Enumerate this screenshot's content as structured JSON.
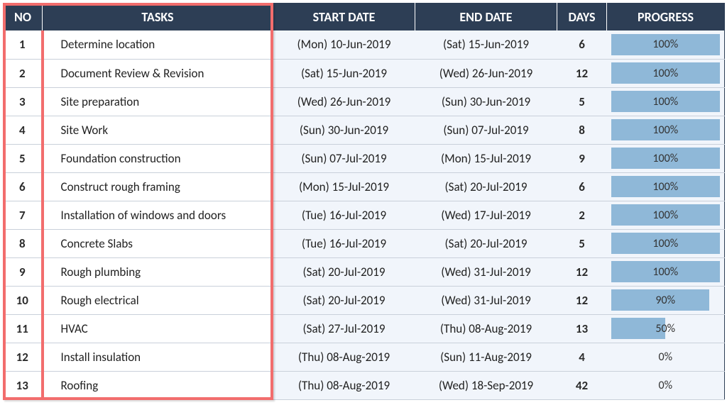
{
  "headers": {
    "no": "NO",
    "tasks": "TASKS",
    "start": "START DATE",
    "end": "END DATE",
    "days": "DAYS",
    "progress": "PROGRESS"
  },
  "rows": [
    {
      "no": "1",
      "task": "Determine location",
      "start": "(Mon) 10-Jun-2019",
      "end": "(Sat) 15-Jun-2019",
      "days": "6",
      "progress": 100
    },
    {
      "no": "2",
      "task": "Document Review & Revision",
      "start": "(Sat) 15-Jun-2019",
      "end": "(Wed) 26-Jun-2019",
      "days": "12",
      "progress": 100
    },
    {
      "no": "3",
      "task": "Site preparation",
      "start": "(Wed) 26-Jun-2019",
      "end": "(Sun) 30-Jun-2019",
      "days": "5",
      "progress": 100
    },
    {
      "no": "4",
      "task": "Site Work",
      "start": "(Sun) 30-Jun-2019",
      "end": "(Sun) 07-Jul-2019",
      "days": "8",
      "progress": 100
    },
    {
      "no": "5",
      "task": "Foundation construction",
      "start": "(Sun) 07-Jul-2019",
      "end": "(Mon) 15-Jul-2019",
      "days": "9",
      "progress": 100
    },
    {
      "no": "6",
      "task": "Construct rough framing",
      "start": "(Mon) 15-Jul-2019",
      "end": "(Sat) 20-Jul-2019",
      "days": "6",
      "progress": 100
    },
    {
      "no": "7",
      "task": "Installation of windows and doors",
      "start": "(Tue) 16-Jul-2019",
      "end": "(Wed) 17-Jul-2019",
      "days": "2",
      "progress": 100
    },
    {
      "no": "8",
      "task": "Concrete Slabs",
      "start": "(Tue) 16-Jul-2019",
      "end": "(Sat) 20-Jul-2019",
      "days": "5",
      "progress": 100
    },
    {
      "no": "9",
      "task": "Rough plumbing",
      "start": "(Sat) 20-Jul-2019",
      "end": "(Wed) 31-Jul-2019",
      "days": "12",
      "progress": 100
    },
    {
      "no": "10",
      "task": "Rough electrical",
      "start": "(Sat) 20-Jul-2019",
      "end": "(Wed) 31-Jul-2019",
      "days": "12",
      "progress": 90
    },
    {
      "no": "11",
      "task": "HVAC",
      "start": "(Sat) 27-Jul-2019",
      "end": "(Thu) 08-Aug-2019",
      "days": "13",
      "progress": 50
    },
    {
      "no": "12",
      "task": "Install insulation",
      "start": "(Thu) 08-Aug-2019",
      "end": "(Sun) 11-Aug-2019",
      "days": "4",
      "progress": 0
    },
    {
      "no": "13",
      "task": "Roofing",
      "start": "(Thu) 08-Aug-2019",
      "end": "(Wed) 18-Sep-2019",
      "days": "42",
      "progress": 0
    }
  ],
  "colors": {
    "header_bg": "#2d3e55",
    "progress_fill": "#8fb8d8",
    "highlight_border": "#f26d6d",
    "alt_row_bg": "#f1f5fb"
  },
  "chart_data": {
    "type": "table",
    "columns": [
      "NO",
      "TASKS",
      "START DATE",
      "END DATE",
      "DAYS",
      "PROGRESS"
    ],
    "rows": [
      [
        "1",
        "Determine location",
        "(Mon) 10-Jun-2019",
        "(Sat) 15-Jun-2019",
        "6",
        "100%"
      ],
      [
        "2",
        "Document Review & Revision",
        "(Sat) 15-Jun-2019",
        "(Wed) 26-Jun-2019",
        "12",
        "100%"
      ],
      [
        "3",
        "Site preparation",
        "(Wed) 26-Jun-2019",
        "(Sun) 30-Jun-2019",
        "5",
        "100%"
      ],
      [
        "4",
        "Site Work",
        "(Sun) 30-Jun-2019",
        "(Sun) 07-Jul-2019",
        "8",
        "100%"
      ],
      [
        "5",
        "Foundation construction",
        "(Sun) 07-Jul-2019",
        "(Mon) 15-Jul-2019",
        "9",
        "100%"
      ],
      [
        "6",
        "Construct rough framing",
        "(Mon) 15-Jul-2019",
        "(Sat) 20-Jul-2019",
        "6",
        "100%"
      ],
      [
        "7",
        "Installation of windows and doors",
        "(Tue) 16-Jul-2019",
        "(Wed) 17-Jul-2019",
        "2",
        "100%"
      ],
      [
        "8",
        "Concrete Slabs",
        "(Tue) 16-Jul-2019",
        "(Sat) 20-Jul-2019",
        "5",
        "100%"
      ],
      [
        "9",
        "Rough plumbing",
        "(Sat) 20-Jul-2019",
        "(Wed) 31-Jul-2019",
        "12",
        "100%"
      ],
      [
        "10",
        "Rough electrical",
        "(Sat) 20-Jul-2019",
        "(Wed) 31-Jul-2019",
        "12",
        "90%"
      ],
      [
        "11",
        "HVAC",
        "(Sat) 27-Jul-2019",
        "(Thu) 08-Aug-2019",
        "13",
        "50%"
      ],
      [
        "12",
        "Install insulation",
        "(Thu) 08-Aug-2019",
        "(Sun) 11-Aug-2019",
        "4",
        "0%"
      ],
      [
        "13",
        "Roofing",
        "(Thu) 08-Aug-2019",
        "(Wed) 18-Sep-2019",
        "42",
        "0%"
      ]
    ]
  }
}
